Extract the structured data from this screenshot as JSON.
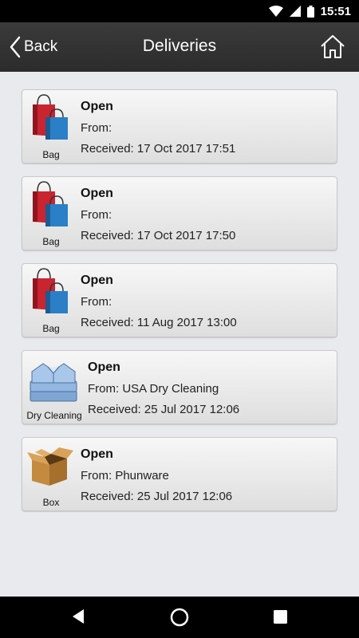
{
  "status_bar": {
    "time": "15:51"
  },
  "header": {
    "back_label": "Back",
    "title": "Deliveries"
  },
  "deliveries": [
    {
      "type_label": "Bag",
      "icon": "shopping-bags-icon",
      "status": "Open",
      "from": "From:",
      "received": "Received: 17 Oct 2017 17:51"
    },
    {
      "type_label": "Bag",
      "icon": "shopping-bags-icon",
      "status": "Open",
      "from": "From:",
      "received": "Received: 17 Oct 2017 17:50"
    },
    {
      "type_label": "Bag",
      "icon": "shopping-bags-icon",
      "status": "Open",
      "from": "From:",
      "received": "Received: 11 Aug 2017 13:00"
    },
    {
      "type_label": "Dry Cleaning",
      "icon": "folded-shirts-icon",
      "status": "Open",
      "from": "From: USA Dry Cleaning",
      "received": "Received: 25 Jul 2017 12:06"
    },
    {
      "type_label": "Box",
      "icon": "cardboard-box-icon",
      "status": "Open",
      "from": "From: Phunware",
      "received": "Received: 25 Jul 2017 12:06"
    }
  ],
  "colors": {
    "header_bg": "#2f2f2f",
    "page_bg": "#e9eaee",
    "card_bg": "#eeeeee"
  }
}
